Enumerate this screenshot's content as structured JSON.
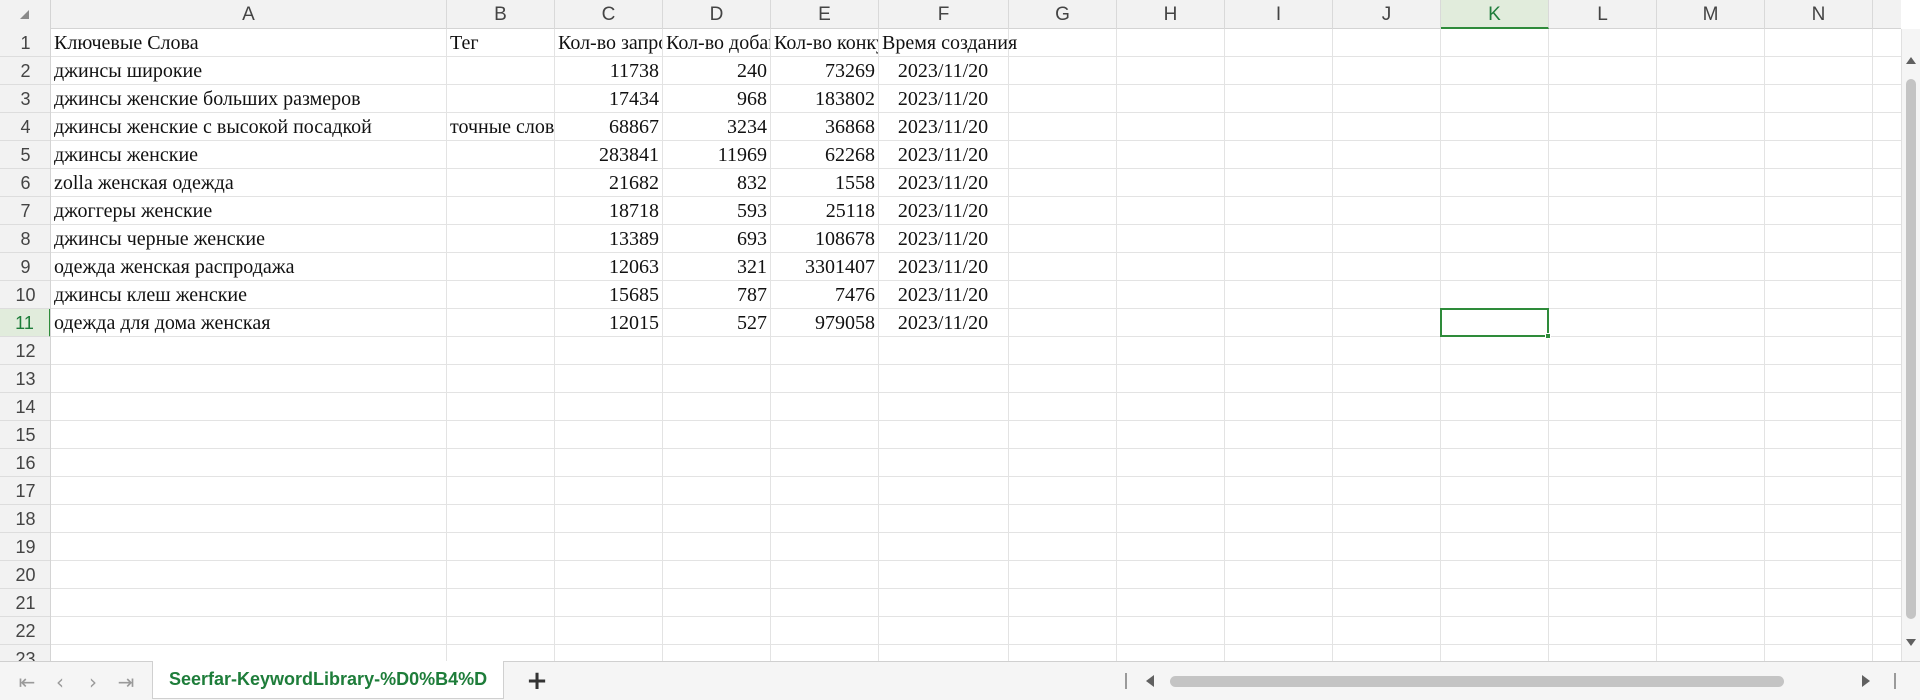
{
  "app": {
    "name": "Spreadsheet"
  },
  "columns": [
    "A",
    "B",
    "C",
    "D",
    "E",
    "F",
    "G",
    "H",
    "I",
    "J",
    "K",
    "L",
    "M",
    "N"
  ],
  "rows": [
    "1",
    "2",
    "3",
    "4",
    "5",
    "6",
    "7",
    "8",
    "9",
    "10",
    "11",
    "12",
    "13",
    "14",
    "15",
    "16",
    "17",
    "18",
    "19",
    "20",
    "21",
    "22",
    "23"
  ],
  "selection": {
    "column": "K",
    "row": "11"
  },
  "headers": {
    "keyword": "Ключевые Слова",
    "tag": "Тег",
    "queries": "Кол-во запросов",
    "added": "Кол-во добавлений",
    "competitors": "Кол-во конкурентов",
    "created": "Время создания"
  },
  "data_rows": [
    {
      "keyword": "джинсы широкие",
      "tag": "",
      "queries": "11738",
      "added": "240",
      "competitors": "73269",
      "created": "2023/11/20"
    },
    {
      "keyword": "джинсы женские больших размеров",
      "tag": "",
      "queries": "17434",
      "added": "968",
      "competitors": "183802",
      "created": "2023/11/20"
    },
    {
      "keyword": "джинсы женские с высокой посадкой",
      "tag": "точные слова",
      "queries": "68867",
      "added": "3234",
      "competitors": "36868",
      "created": "2023/11/20"
    },
    {
      "keyword": "джинсы женские",
      "tag": "",
      "queries": "283841",
      "added": "11969",
      "competitors": "62268",
      "created": "2023/11/20"
    },
    {
      "keyword": "zolla женская одежда",
      "tag": "",
      "queries": "21682",
      "added": "832",
      "competitors": "1558",
      "created": "2023/11/20"
    },
    {
      "keyword": "джоггеры женские",
      "tag": "",
      "queries": "18718",
      "added": "593",
      "competitors": "25118",
      "created": "2023/11/20"
    },
    {
      "keyword": "джинсы черные женские",
      "tag": "",
      "queries": "13389",
      "added": "693",
      "competitors": "108678",
      "created": "2023/11/20"
    },
    {
      "keyword": "одежда женская распродажа",
      "tag": "",
      "queries": "12063",
      "added": "321",
      "competitors": "3301407",
      "created": "2023/11/20"
    },
    {
      "keyword": "джинсы клеш женские",
      "tag": "",
      "queries": "15685",
      "added": "787",
      "competitors": "7476",
      "created": "2023/11/20"
    },
    {
      "keyword": "одежда для дома женская",
      "tag": "",
      "queries": "12015",
      "added": "527",
      "competitors": "979058",
      "created": "2023/11/20"
    }
  ],
  "sheet_tabs": [
    {
      "label": "Seerfar-KeywordLibrary-%D0%B4%D"
    }
  ],
  "add_sheet_label": "+",
  "nav_icons": [
    "first-sheet-icon",
    "prev-sheet-icon",
    "next-sheet-icon",
    "last-sheet-icon"
  ],
  "colors": {
    "accent": "#2e8b3a",
    "header_bg": "#f2f2f2",
    "grid": "#e3e3e3",
    "selected_header_bg": "#e1ecdc"
  }
}
